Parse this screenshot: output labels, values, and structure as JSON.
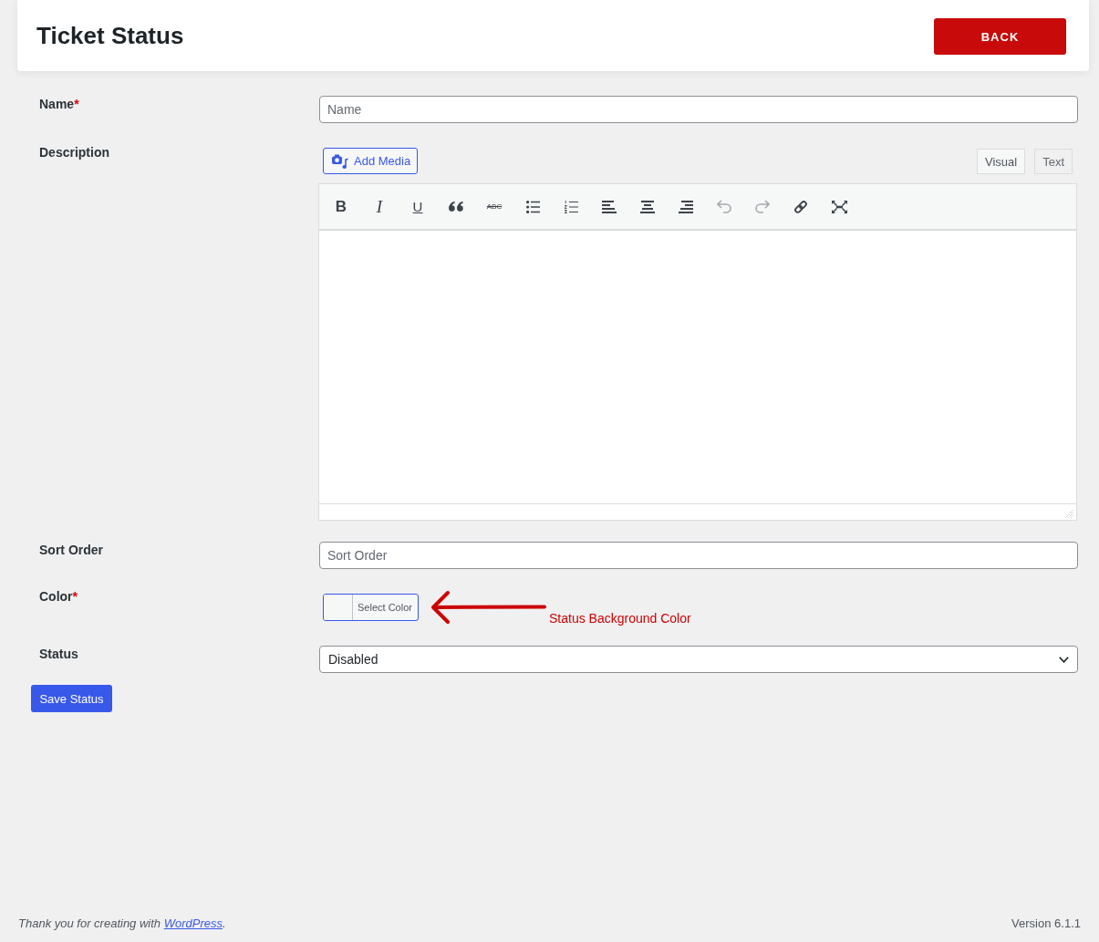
{
  "header": {
    "title": "Ticket Status",
    "back_button": "BACK"
  },
  "fields": [
    {
      "kind": "text",
      "label": "Name",
      "required_mark": "*",
      "placeholder": "Name"
    },
    {
      "kind": "editor",
      "label": "Description",
      "add_media": "Add Media",
      "tabs": [
        {
          "label": "Visual",
          "selected": true
        },
        {
          "label": "Text",
          "selected": false
        }
      ],
      "toolbar": [
        {
          "kind": "bold",
          "label": "B",
          "disabled": false
        },
        {
          "kind": "italic",
          "label": "I",
          "disabled": false
        },
        {
          "kind": "underline",
          "label": "U",
          "disabled": false
        },
        {
          "kind": "blockquote",
          "disabled": false
        },
        {
          "kind": "strikethrough",
          "label": "ABC",
          "disabled": false
        },
        {
          "kind": "bullet-list",
          "disabled": false
        },
        {
          "kind": "numbered-list",
          "disabled": false
        },
        {
          "kind": "align-left",
          "disabled": false
        },
        {
          "kind": "align-center",
          "disabled": false
        },
        {
          "kind": "align-right",
          "disabled": false
        },
        {
          "kind": "undo",
          "disabled": true
        },
        {
          "kind": "redo",
          "disabled": true
        },
        {
          "kind": "link",
          "disabled": false
        },
        {
          "kind": "fullscreen",
          "disabled": false
        }
      ]
    },
    {
      "kind": "text",
      "label": "Sort Order",
      "placeholder": "Sort Order"
    },
    {
      "kind": "color",
      "label": "Color",
      "required_mark": "*",
      "button": "Select Color",
      "annotation": "Status Background Color"
    },
    {
      "kind": "select",
      "label": "Status",
      "value": "Disabled"
    }
  ],
  "save_button": "Save Status",
  "footer": {
    "text": "Thank you for creating with ",
    "link": "WordPress",
    "end": ".",
    "version": "Version 6.1.1"
  }
}
